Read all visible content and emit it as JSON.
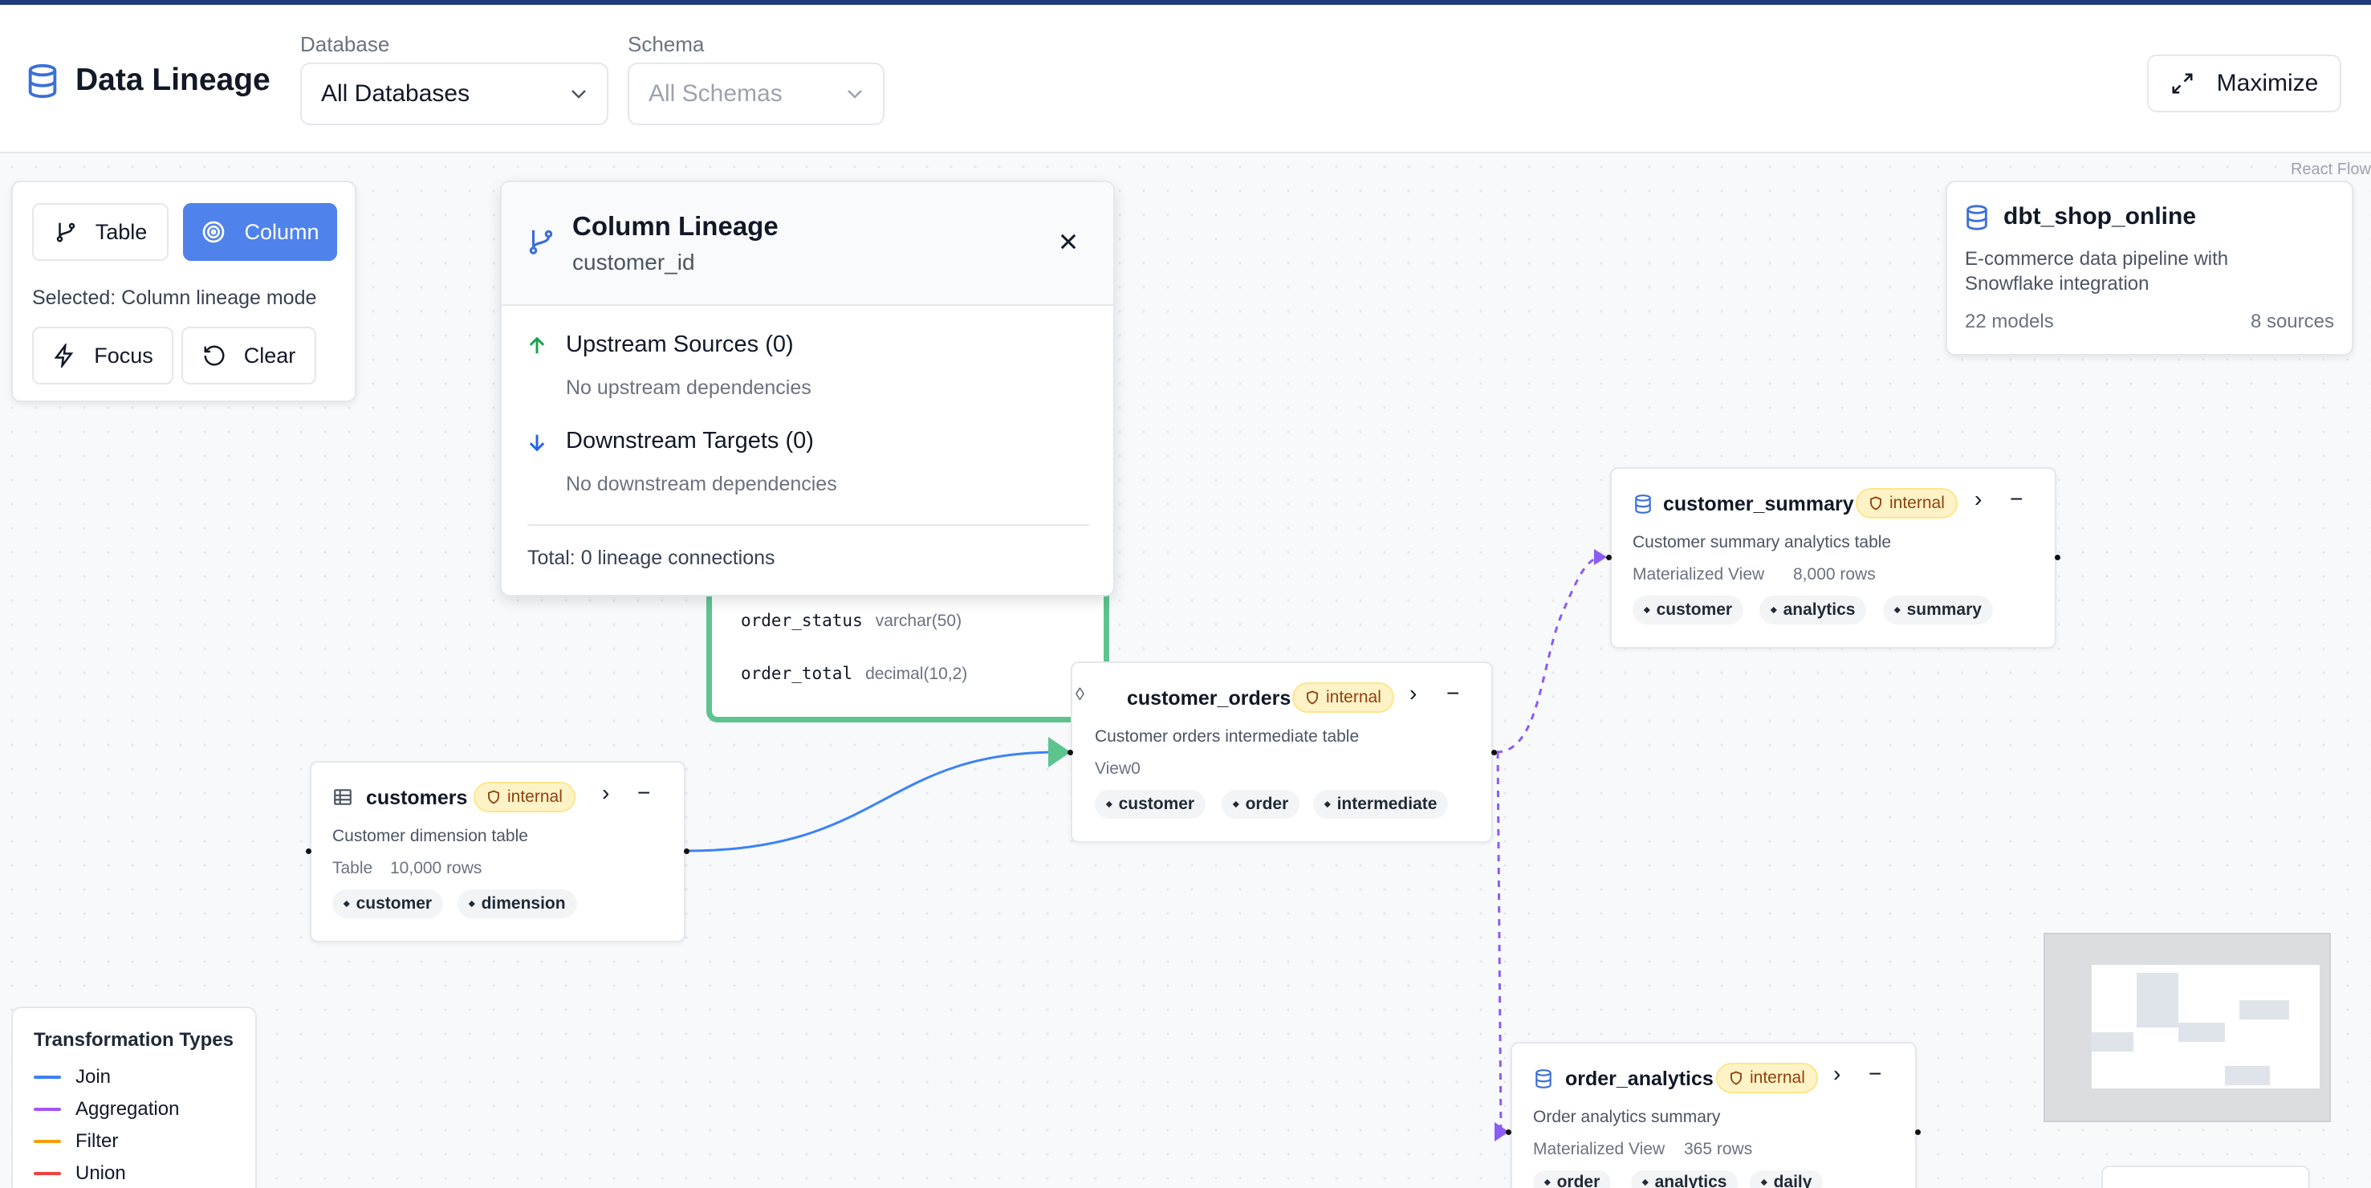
{
  "header": {
    "title": "Data Lineage",
    "database": {
      "label": "Database",
      "value": "All Databases"
    },
    "schema": {
      "label": "Schema",
      "placeholder": "All Schemas"
    },
    "maximize_label": "Maximize"
  },
  "canvas": {
    "attribution": "React Flow"
  },
  "controls": {
    "table_label": "Table",
    "column_label": "Column",
    "selected_text": "Selected: Column lineage mode",
    "focus_label": "Focus",
    "clear_label": "Clear"
  },
  "project": {
    "name": "dbt_shop_online",
    "description": "E-commerce data pipeline with Snowflake integration",
    "models": "22 models",
    "sources": "8 sources"
  },
  "popup": {
    "title": "Column Lineage",
    "subtitle": "customer_id",
    "upstream_title": "Upstream Sources (0)",
    "upstream_empty": "No upstream dependencies",
    "downstream_title": "Downstream Targets (0)",
    "downstream_empty": "No downstream dependencies",
    "total": "Total: 0 lineage connections"
  },
  "orders_node_columns": [
    {
      "name": "order_status",
      "type": "varchar(50)"
    },
    {
      "name": "order_total",
      "type": "decimal(10,2)"
    }
  ],
  "nodes": {
    "customers": {
      "name": "customers",
      "badge": "internal",
      "description": "Customer dimension table",
      "kind": "Table",
      "rows": "10,000 rows",
      "tags": [
        "customer",
        "dimension"
      ]
    },
    "customer_orders": {
      "name": "customer_orders",
      "badge": "internal",
      "description": "Customer orders intermediate table",
      "kind": "View0",
      "tags": [
        "customer",
        "order",
        "intermediate"
      ]
    },
    "customer_summary": {
      "name": "customer_summary",
      "badge": "internal",
      "description": "Customer summary analytics table",
      "kind": "Materialized View",
      "rows": "8,000 rows",
      "tags": [
        "customer",
        "analytics",
        "summary"
      ]
    },
    "order_analytics": {
      "name": "order_analytics",
      "badge": "internal",
      "description": "Order analytics summary",
      "kind": "Materialized View",
      "rows": "365 rows",
      "tags": [
        "order",
        "analytics",
        "daily"
      ]
    }
  },
  "legend": {
    "title": "Transformation Types",
    "items": [
      {
        "label": "Join",
        "color": "#3b82f6"
      },
      {
        "label": "Aggregation",
        "color": "#a855f7"
      },
      {
        "label": "Filter",
        "color": "#f59e0b"
      },
      {
        "label": "Union",
        "color": "#ef4444"
      }
    ]
  },
  "colors": {
    "accent": "#4f82ea",
    "join_edge": "#3b82f6",
    "aggregation_edge": "#8b5cf6",
    "selected_outline": "#5ec48f",
    "badge_bg": "#fef3c7"
  }
}
